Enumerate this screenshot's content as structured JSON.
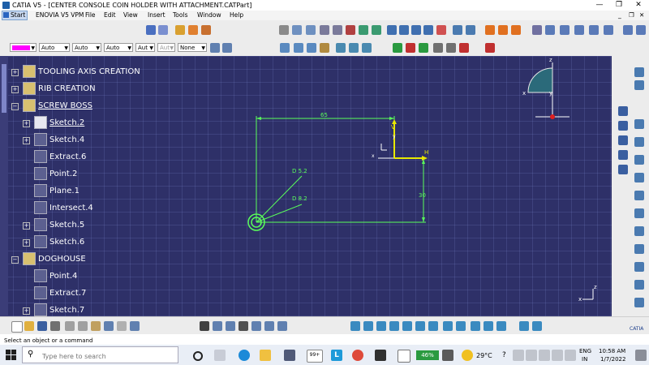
{
  "window": {
    "title": "CATIA V5 - [CENTER CONSOLE COIN HOLDER WITH ATTACHMENT.CATPart]",
    "minimize": "—",
    "restore": "❐",
    "close": "✕"
  },
  "menubar": {
    "items": [
      "Start",
      "ENOVIA V5 VPM",
      "File",
      "Edit",
      "View",
      "Insert",
      "Tools",
      "Window",
      "Help"
    ],
    "doc_controls": [
      "_",
      "❐",
      "✕"
    ]
  },
  "graphic_props": {
    "color": "#ff00ff",
    "linetype": "Auto",
    "thickness": "Auto",
    "point": "Auto",
    "layer_a": "Aut",
    "layer_b": "Aut",
    "none": "None"
  },
  "tree": {
    "rows": [
      {
        "label": "TOOLING AXIS CREATION"
      },
      {
        "label": "RIB CREATION"
      },
      {
        "label": "SCREW BOSS"
      },
      {
        "label": "Sketch.2"
      },
      {
        "label": "Sketch.4"
      },
      {
        "label": "Extract.6"
      },
      {
        "label": "Point.2"
      },
      {
        "label": "Plane.1"
      },
      {
        "label": "Intersect.4"
      },
      {
        "label": "Sketch.5"
      },
      {
        "label": "Sketch.6"
      },
      {
        "label": "DOGHOUSE"
      },
      {
        "label": "Point.4"
      },
      {
        "label": "Extract.7"
      },
      {
        "label": "Sketch.7"
      }
    ]
  },
  "sketch": {
    "dim_horizontal": "65",
    "dim_vertical": "30",
    "dia_outer": "D 5.2",
    "dia_inner": "D 8.2",
    "axis_h": "H",
    "axis_v": "V",
    "axis_x": "x",
    "axis_y": "y",
    "accent": "#5aff5a"
  },
  "compass": {
    "x": "x",
    "y": "y",
    "z": "z"
  },
  "mini_axis": {
    "z": "z",
    "x": "x"
  },
  "status": {
    "prompt": "Select an object or a command"
  },
  "taskbar": {
    "search_placeholder": "Type here to search",
    "badge_99": "99+",
    "battery": "46%",
    "temperature": "29°C",
    "lang_top": "ENG",
    "lang_bottom": "IN",
    "time": "10:58 AM",
    "date": "1/7/2022"
  },
  "icons": {
    "tree_expand": "+",
    "tree_collapse": "−",
    "brand": "CATIA"
  }
}
